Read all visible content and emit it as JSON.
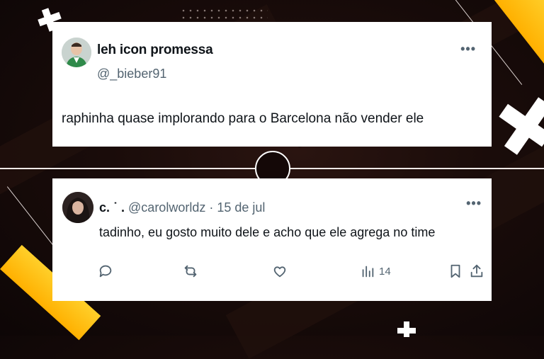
{
  "tweet": {
    "display_name": "leh icon promessa",
    "handle": "@_bieber91",
    "text": "raphinha quase implorando para o Barcelona não vender ele",
    "more_icon": "more-horizontal-icon"
  },
  "reply": {
    "display_name": "c. ˙ .",
    "handle_date": "@carolworldz · 15 de jul",
    "text": "tadinho, eu gosto muito dele e acho que ele agrega no time",
    "more_icon": "more-horizontal-icon",
    "actions": [
      {
        "icon": "reply-icon",
        "count": ""
      },
      {
        "icon": "retweet-icon",
        "count": ""
      },
      {
        "icon": "like-icon",
        "count": ""
      },
      {
        "icon": "views-icon",
        "count": "14"
      },
      {
        "icon": "bookmark-icon",
        "count": ""
      },
      {
        "icon": "share-icon",
        "count": ""
      }
    ]
  },
  "colors": {
    "accent_yellow": "#ffb000",
    "background": "#1a0c0a",
    "text_primary": "#0f1419",
    "text_secondary": "#536471"
  }
}
